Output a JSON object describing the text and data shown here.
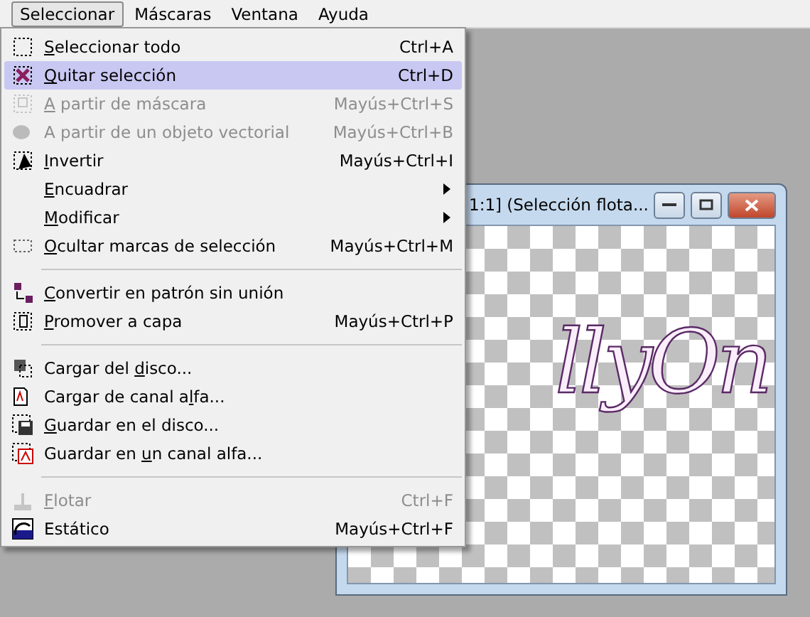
{
  "menubar": [
    {
      "label": "Seleccionar",
      "selected": true
    },
    {
      "label": "Máscaras",
      "selected": false
    },
    {
      "label": "Ventana",
      "selected": false
    },
    {
      "label": "Ayuda",
      "selected": false
    }
  ],
  "menu": [
    {
      "kind": "item",
      "key": "S",
      "post": "eleccionar todo",
      "shortcut": "Ctrl+A",
      "disabled": false,
      "selected": false,
      "submenu": false
    },
    {
      "kind": "item",
      "key": "Q",
      "post": "uitar selección",
      "shortcut": "Ctrl+D",
      "disabled": false,
      "selected": true,
      "submenu": false
    },
    {
      "kind": "item",
      "key": "A",
      "post": " partir de máscara",
      "shortcut": "Mayús+Ctrl+S",
      "disabled": true,
      "selected": false,
      "submenu": false
    },
    {
      "kind": "item",
      "pre": "A partir de un objeto vectorial",
      "shortcut": "Mayús+Ctrl+B",
      "disabled": true,
      "selected": false,
      "submenu": false
    },
    {
      "kind": "item",
      "key": "I",
      "post": "nvertir",
      "shortcut": "Mayús+Ctrl+I",
      "disabled": false,
      "selected": false,
      "submenu": false
    },
    {
      "kind": "item",
      "key": "E",
      "post": "ncuadrar",
      "disabled": false,
      "selected": false,
      "submenu": true
    },
    {
      "kind": "item",
      "key": "M",
      "post": "odificar",
      "disabled": false,
      "selected": false,
      "submenu": true
    },
    {
      "kind": "item",
      "key": "O",
      "post": "cultar marcas de selección",
      "shortcut": "Mayús+Ctrl+M",
      "disabled": false,
      "selected": false,
      "submenu": false
    },
    {
      "kind": "separator"
    },
    {
      "kind": "item",
      "key": "C",
      "post": "onvertir en patrón sin unión",
      "disabled": false,
      "selected": false,
      "submenu": false
    },
    {
      "kind": "item",
      "key": "P",
      "post": "romover a capa",
      "shortcut": "Mayús+Ctrl+P",
      "disabled": false,
      "selected": false,
      "submenu": false
    },
    {
      "kind": "separator"
    },
    {
      "kind": "item",
      "pre": "Cargar del ",
      "key": "d",
      "post": "isco...",
      "disabled": false,
      "selected": false,
      "submenu": false
    },
    {
      "kind": "item",
      "pre": "Cargar de canal a",
      "key": "l",
      "post": "fa...",
      "disabled": false,
      "selected": false,
      "submenu": false
    },
    {
      "kind": "item",
      "key": "G",
      "post": "uardar en el disco...",
      "disabled": false,
      "selected": false,
      "submenu": false
    },
    {
      "kind": "item",
      "pre": "Guardar en ",
      "key": "u",
      "post": "n canal alfa...",
      "disabled": false,
      "selected": false,
      "submenu": false
    },
    {
      "kind": "separator"
    },
    {
      "kind": "item",
      "key": "F",
      "post": "lotar",
      "shortcut": "Ctrl+F",
      "disabled": true,
      "selected": false,
      "submenu": false
    },
    {
      "kind": "item",
      "pre": "Estático",
      "shortcut": "Mayús+Ctrl+F",
      "disabled": false,
      "selected": false,
      "submenu": false
    }
  ],
  "image_window": {
    "title": "1:1] (Selección flota...",
    "canvas_text": "llyOn"
  }
}
